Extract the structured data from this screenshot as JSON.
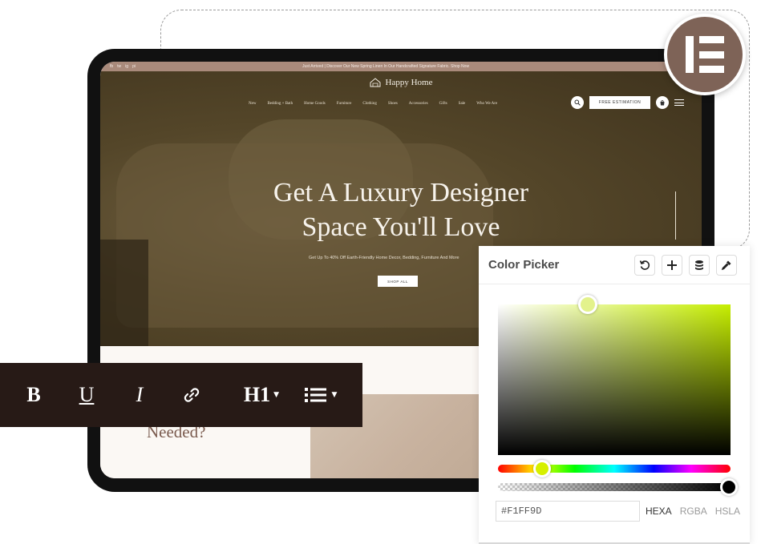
{
  "site": {
    "announcement": "Just Arrived | Discover Our New Spring Linen In Our Handcrafted Signature Fabric. Shop Now",
    "socials": [
      "fb",
      "tw",
      "ig",
      "pi"
    ],
    "logo_text": "Happy Home",
    "nav": [
      "New",
      "Bedding + Bath",
      "Home Goods",
      "Furniture",
      "Clothing",
      "Shoes",
      "Accessories",
      "Gifts",
      "Sale",
      "Who We Are"
    ],
    "estimate_label": "FREE ESTIMATION",
    "headline_line1": "Get A Luxury Designer",
    "headline_line2": "Space You'll Love",
    "subline": "Get Up To 40% Off Earth-Friendly Home Decor, Bedding, Furniture And More",
    "shop_label": "SHOP ALL",
    "section_text": "Needed?"
  },
  "toolbar": {
    "bold": "B",
    "underline": "U",
    "italic": "I",
    "heading": "H1",
    "icons": [
      "link-icon",
      "list-icon",
      "caret-down-icon"
    ]
  },
  "color_picker": {
    "title": "Color Picker",
    "hex_value": "#F1FF9D",
    "modes": [
      "HEXA",
      "RGBA",
      "HSLA"
    ],
    "active_mode": "HEXA",
    "hue_color": "#D6F000",
    "selected_color": "#F1FF9D",
    "actions": [
      "reset-icon",
      "plus-icon",
      "database-icon",
      "eyedropper-icon"
    ]
  },
  "colors": {
    "brand": "#7E6357",
    "toolbar_bg": "#271A16",
    "accent_text": "#7A5B4E"
  }
}
